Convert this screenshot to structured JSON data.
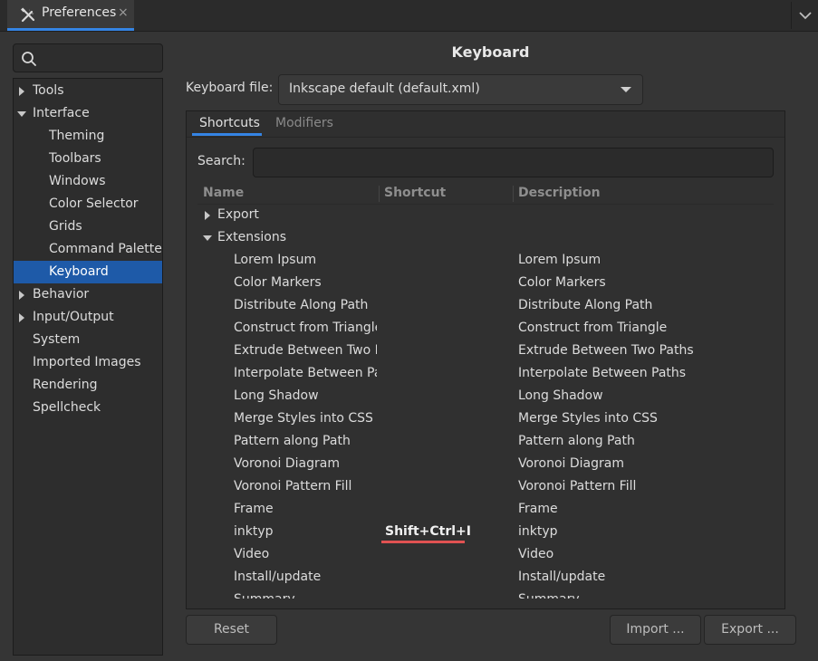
{
  "window": {
    "tab_title": "Preferences",
    "tab_close": "×"
  },
  "sidebar": {
    "items": [
      {
        "label": "Tools",
        "level": 0,
        "expander": "collapsed",
        "selected": false
      },
      {
        "label": "Interface",
        "level": 0,
        "expander": "expanded",
        "selected": false
      },
      {
        "label": "Theming",
        "level": 1,
        "expander": "none",
        "selected": false
      },
      {
        "label": "Toolbars",
        "level": 1,
        "expander": "none",
        "selected": false
      },
      {
        "label": "Windows",
        "level": 1,
        "expander": "none",
        "selected": false
      },
      {
        "label": "Color Selector",
        "level": 1,
        "expander": "none",
        "selected": false
      },
      {
        "label": "Grids",
        "level": 1,
        "expander": "none",
        "selected": false
      },
      {
        "label": "Command Palette",
        "level": 1,
        "expander": "none",
        "selected": false
      },
      {
        "label": "Keyboard",
        "level": 1,
        "expander": "none",
        "selected": true
      },
      {
        "label": "Behavior",
        "level": 0,
        "expander": "collapsed",
        "selected": false
      },
      {
        "label": "Input/Output",
        "level": 0,
        "expander": "collapsed",
        "selected": false
      },
      {
        "label": "System",
        "level": 0,
        "expander": "none",
        "selected": false
      },
      {
        "label": "Imported Images",
        "level": 0,
        "expander": "none",
        "selected": false
      },
      {
        "label": "Rendering",
        "level": 0,
        "expander": "none",
        "selected": false
      },
      {
        "label": "Spellcheck",
        "level": 0,
        "expander": "none",
        "selected": false
      }
    ]
  },
  "panel": {
    "title": "Keyboard",
    "keyboard_file_label": "Keyboard file:",
    "keyboard_file_value": "Inkscape default (default.xml)",
    "tabs": {
      "shortcuts": "Shortcuts",
      "modifiers": "Modifiers"
    },
    "search_label": "Search:",
    "search_value": "",
    "columns": {
      "name": "Name",
      "shortcut": "Shortcut",
      "description": "Description"
    },
    "rows": [
      {
        "type": "group",
        "expander": "collapsed",
        "name": "Export",
        "shortcut": "",
        "description": ""
      },
      {
        "type": "group",
        "expander": "expanded",
        "name": "Extensions",
        "shortcut": "",
        "description": ""
      },
      {
        "type": "item",
        "name": "Lorem Ipsum",
        "shortcut": "",
        "description": "Lorem Ipsum"
      },
      {
        "type": "item",
        "name": "Color Markers",
        "shortcut": "",
        "description": "Color Markers"
      },
      {
        "type": "item",
        "name": "Distribute Along Path",
        "shortcut": "",
        "description": "Distribute Along Path"
      },
      {
        "type": "item",
        "name": "Construct from Triangle",
        "shortcut": "",
        "description": "Construct from Triangle"
      },
      {
        "type": "item",
        "name": "Extrude Between Two Pa",
        "shortcut": "",
        "description": "Extrude Between Two Paths"
      },
      {
        "type": "item",
        "name": "Interpolate Between Pat",
        "shortcut": "",
        "description": "Interpolate Between Paths"
      },
      {
        "type": "item",
        "name": "Long Shadow",
        "shortcut": "",
        "description": "Long Shadow"
      },
      {
        "type": "item",
        "name": "Merge Styles into CSS",
        "shortcut": "",
        "description": "Merge Styles into CSS"
      },
      {
        "type": "item",
        "name": "Pattern along Path",
        "shortcut": "",
        "description": "Pattern along Path"
      },
      {
        "type": "item",
        "name": "Voronoi Diagram",
        "shortcut": "",
        "description": "Voronoi Diagram"
      },
      {
        "type": "item",
        "name": "Voronoi Pattern Fill",
        "shortcut": "",
        "description": "Voronoi Pattern Fill"
      },
      {
        "type": "item",
        "name": "Frame",
        "shortcut": "",
        "description": "Frame"
      },
      {
        "type": "item",
        "name": "inktyp",
        "shortcut": "Shift+Ctrl+I",
        "description": "inktyp"
      },
      {
        "type": "item",
        "name": "Video",
        "shortcut": "",
        "description": "Video"
      },
      {
        "type": "item",
        "name": "Install/update",
        "shortcut": "",
        "description": "Install/update"
      },
      {
        "type": "item",
        "name": "Summary",
        "shortcut": "",
        "description": "Summary"
      }
    ]
  },
  "buttons": {
    "reset": "Reset",
    "import": "Import ...",
    "export": "Export ..."
  },
  "colors": {
    "accent": "#3584e4",
    "selection": "#1e5aa8",
    "shortcut_underline": "#e05252"
  }
}
